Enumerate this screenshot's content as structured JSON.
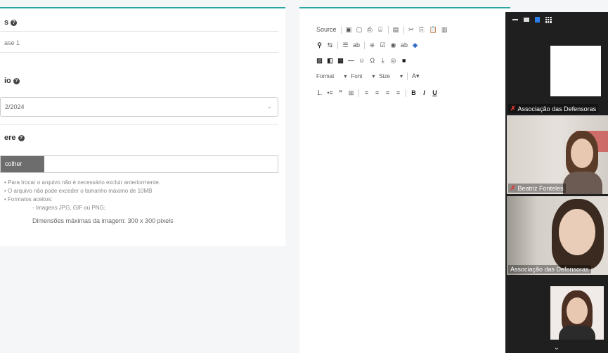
{
  "form": {
    "field1_label": "s",
    "field1_value": "ase 1",
    "field2_label": "io",
    "field2_value": "2/2024",
    "field3_label": "ere",
    "file_button": "colher",
    "notes": [
      "• Para trocar o arquivo não é necessário excluir anteriormente.",
      "• O arquivo não pode exceder o tamanho máximo de 10MB",
      "• Formatos aceitos:"
    ],
    "sub_note": "- Imagens JPG, GIF ou PNG;",
    "dimensions": "Dimensões máximas da imagem: 300 x 300 pixels"
  },
  "editor": {
    "source_label": "Source",
    "format_label": "Format",
    "font_label": "Font",
    "size_label": "Size",
    "bold": "B",
    "italic": "I",
    "underline": "U"
  },
  "zoom": {
    "participants": [
      {
        "name": "Associação das Defensoras",
        "muted": true
      },
      {
        "name": "Beatriz Fonteles",
        "muted": true
      },
      {
        "name": "Associação das Defensoras",
        "muted": false
      },
      {
        "name": "",
        "muted": false
      }
    ],
    "accent_color": "#2b7de9"
  },
  "colors": {
    "accent": "#29a7a0",
    "muted_red": "#e53935"
  }
}
